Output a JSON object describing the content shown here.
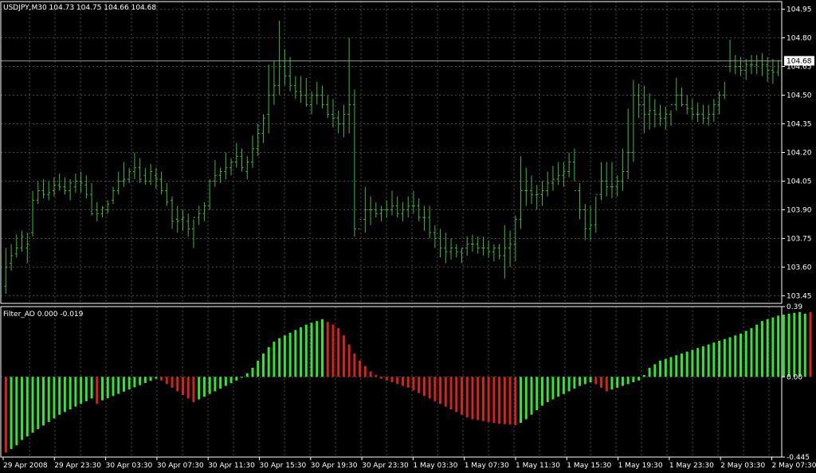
{
  "colors": {
    "background": "#000000",
    "grid": "#4a4a4a",
    "frame": "#ffffff",
    "price_bar": "#3cb93c",
    "ao_up": "#2ee82e",
    "ao_down": "#d7221c",
    "text": "#ffffff",
    "last_price_line": "#9a9a9a",
    "last_price_badge_bg": "#ffffff",
    "last_price_badge_text": "#000000"
  },
  "main_panel": {
    "header": "USDJPY,M30  104.73 104.75 104.66 104.68",
    "last_price": 104.68,
    "last_price_label": "104.68"
  },
  "indicator_panel": {
    "header": "Filter_AO 0.000 -0.019"
  },
  "chart_data": [
    {
      "type": "ohlc",
      "title": "USDJPY,M30",
      "ylim": [
        103.41,
        104.99
      ],
      "yticks": [
        "104.95",
        "104.80",
        "104.65",
        "104.50",
        "104.35",
        "104.20",
        "104.05",
        "103.90",
        "103.75",
        "103.60",
        "103.45"
      ],
      "ytick_values": [
        104.95,
        104.8,
        104.65,
        104.5,
        104.35,
        104.2,
        104.05,
        103.9,
        103.75,
        103.6,
        103.45
      ],
      "grid": true,
      "series": [
        {
          "high": [
            103.7,
            103.72,
            103.77,
            103.79,
            103.78,
            104.0,
            104.05,
            104.06,
            104.05,
            104.07,
            104.09,
            104.07,
            104.06,
            104.09,
            104.1,
            104.08,
            104.04,
            103.94,
            103.92,
            103.95,
            104.02,
            104.1,
            104.15,
            104.12,
            104.2,
            104.17,
            104.12,
            104.14,
            104.12,
            104.1,
            104.04,
            103.97,
            103.92,
            103.9,
            103.88,
            103.85,
            103.92,
            103.94,
            104.06,
            104.16,
            104.12,
            104.2,
            104.17,
            104.25,
            104.22,
            104.18,
            104.29,
            104.35,
            104.4,
            104.66,
            104.68,
            104.89,
            104.74,
            104.7,
            104.6,
            104.6,
            104.59,
            104.52,
            104.57,
            104.55,
            104.5,
            104.48,
            104.42,
            104.45,
            104.8,
            104.53,
            103.75,
            104.02,
            103.97,
            103.94,
            103.92,
            103.95,
            104.0,
            103.97,
            103.94,
            103.97,
            104.0,
            103.96,
            103.92,
            103.92,
            103.82,
            103.8,
            103.78,
            103.75,
            103.72,
            103.7,
            103.76,
            103.77,
            103.76,
            103.76,
            103.74,
            103.72,
            103.72,
            103.82,
            103.79,
            103.87,
            104.18,
            104.12,
            104.08,
            104.03,
            104.05,
            104.1,
            104.13,
            104.15,
            104.15,
            104.2,
            104.22,
            104.04,
            103.93,
            103.92,
            103.97,
            104.15,
            104.15,
            104.15,
            104.08,
            104.22,
            104.43,
            104.58,
            104.56,
            104.55,
            104.51,
            104.48,
            104.45,
            104.44,
            104.42,
            104.59,
            104.54,
            104.5,
            104.48,
            104.46,
            104.45,
            104.45,
            104.48,
            104.52,
            104.57,
            104.79,
            104.71,
            104.7,
            104.69,
            104.71,
            104.71,
            104.72,
            104.7,
            104.69,
            104.68
          ],
          "low": [
            103.46,
            103.58,
            103.65,
            103.68,
            103.62,
            103.76,
            103.93,
            103.96,
            103.95,
            103.97,
            104.0,
            103.98,
            103.95,
            103.99,
            103.99,
            103.96,
            103.87,
            103.84,
            103.86,
            103.88,
            103.93,
            103.98,
            104.02,
            104.04,
            104.06,
            104.04,
            104.03,
            104.03,
            104.01,
            103.98,
            103.92,
            103.8,
            103.78,
            103.79,
            103.76,
            103.7,
            103.82,
            103.84,
            103.9,
            104.02,
            104.04,
            104.06,
            104.08,
            104.12,
            104.1,
            104.06,
            104.12,
            104.18,
            104.25,
            104.3,
            104.45,
            104.5,
            104.55,
            104.52,
            104.48,
            104.46,
            104.44,
            104.4,
            104.45,
            104.43,
            104.38,
            104.33,
            104.3,
            104.28,
            104.3,
            103.76,
            103.75,
            103.78,
            103.82,
            103.86,
            103.84,
            103.86,
            103.87,
            103.86,
            103.84,
            103.86,
            103.88,
            103.84,
            103.79,
            103.75,
            103.7,
            103.65,
            103.62,
            103.64,
            103.65,
            103.62,
            103.66,
            103.68,
            103.67,
            103.66,
            103.65,
            103.63,
            103.64,
            103.54,
            103.6,
            103.63,
            103.8,
            103.92,
            103.93,
            103.9,
            103.92,
            103.97,
            104.0,
            104.03,
            104.02,
            104.07,
            104.05,
            103.85,
            103.74,
            103.74,
            103.78,
            103.95,
            103.97,
            103.96,
            103.97,
            104.0,
            104.06,
            104.15,
            104.38,
            104.3,
            104.32,
            104.33,
            104.34,
            104.32,
            104.34,
            104.42,
            104.44,
            104.4,
            104.37,
            104.36,
            104.35,
            104.34,
            104.36,
            104.4,
            104.48,
            104.62,
            104.61,
            104.6,
            104.58,
            104.61,
            104.61,
            104.6,
            104.57,
            104.56,
            104.6
          ],
          "open": [
            103.5,
            103.62,
            103.67,
            103.7,
            103.7,
            103.78,
            103.95,
            104.0,
            103.98,
            104.0,
            104.03,
            104.02,
            104.0,
            104.02,
            104.05,
            104.03,
            103.98,
            103.9,
            103.88,
            103.9,
            103.95,
            104.0,
            104.05,
            104.06,
            104.1,
            104.12,
            104.08,
            104.05,
            104.08,
            104.06,
            104.0,
            103.95,
            103.85,
            103.85,
            103.84,
            103.8,
            103.86,
            103.88,
            103.92,
            104.05,
            104.08,
            104.1,
            104.12,
            104.15,
            104.18,
            104.1,
            104.15,
            104.22,
            104.3,
            104.4,
            104.5,
            104.55,
            104.65,
            104.6,
            104.55,
            104.52,
            104.5,
            104.45,
            104.5,
            104.5,
            104.45,
            104.4,
            104.38,
            104.35,
            104.4,
            104.45,
            103.8,
            103.85,
            103.9,
            103.9,
            103.88,
            103.9,
            103.9,
            103.92,
            103.88,
            103.9,
            103.92,
            103.92,
            103.86,
            103.86,
            103.78,
            103.75,
            103.7,
            103.68,
            103.7,
            103.68,
            103.7,
            103.72,
            103.72,
            103.7,
            103.7,
            103.68,
            103.7,
            103.66,
            103.7,
            103.72,
            103.85,
            104.0,
            104.0,
            103.98,
            103.98,
            104.0,
            104.04,
            104.06,
            104.08,
            104.1,
            104.15,
            104.0,
            103.9,
            103.8,
            103.82,
            103.98,
            104.05,
            104.02,
            104.02,
            104.05,
            104.1,
            104.2,
            104.5,
            104.45,
            104.4,
            104.42,
            104.4,
            104.38,
            104.4,
            104.45,
            104.5,
            104.45,
            104.43,
            104.4,
            104.4,
            104.38,
            104.4,
            104.45,
            104.5,
            104.65,
            104.68,
            104.65,
            104.63,
            104.66,
            104.66,
            104.68,
            104.66,
            104.63,
            104.62
          ],
          "close": [
            103.6,
            103.66,
            103.7,
            103.76,
            103.72,
            103.95,
            104.0,
            103.98,
            103.99,
            104.03,
            104.02,
            104.0,
            104.04,
            104.05,
            104.04,
            103.98,
            103.88,
            103.88,
            103.91,
            103.93,
            104.0,
            104.05,
            104.06,
            104.1,
            104.12,
            104.06,
            104.05,
            104.1,
            104.06,
            104.0,
            103.94,
            103.84,
            103.84,
            103.86,
            103.8,
            103.86,
            103.88,
            103.92,
            104.05,
            104.08,
            104.1,
            104.12,
            104.15,
            104.18,
            104.12,
            104.15,
            104.22,
            104.3,
            104.38,
            104.5,
            104.55,
            104.65,
            104.6,
            104.55,
            104.52,
            104.5,
            104.45,
            104.5,
            104.5,
            104.45,
            104.4,
            104.38,
            104.35,
            104.4,
            104.45,
            103.8,
            103.85,
            103.9,
            103.9,
            103.88,
            103.9,
            103.9,
            103.92,
            103.88,
            103.9,
            103.92,
            103.92,
            103.86,
            103.86,
            103.78,
            103.75,
            103.7,
            103.68,
            103.7,
            103.68,
            103.7,
            103.72,
            103.72,
            103.7,
            103.7,
            103.68,
            103.7,
            103.66,
            103.7,
            103.72,
            103.85,
            104.0,
            104.0,
            103.98,
            103.98,
            104.0,
            104.04,
            104.06,
            104.08,
            104.1,
            104.15,
            104.0,
            103.9,
            103.8,
            103.82,
            103.98,
            104.05,
            104.02,
            104.02,
            104.05,
            104.1,
            104.2,
            104.5,
            104.45,
            104.4,
            104.42,
            104.4,
            104.38,
            104.4,
            104.45,
            104.5,
            104.45,
            104.43,
            104.4,
            104.4,
            104.38,
            104.4,
            104.45,
            104.5,
            104.65,
            104.68,
            104.65,
            104.63,
            104.66,
            104.66,
            104.68,
            104.66,
            104.63,
            104.62,
            104.68
          ]
        }
      ]
    },
    {
      "type": "bar",
      "title": "Filter_AO",
      "ylim": [
        -0.445,
        0.39
      ],
      "yticks": [
        "0.39",
        "0.00",
        "-0.445"
      ],
      "ytick_values": [
        0.39,
        0.0,
        -0.445
      ],
      "grid": true,
      "series": [
        {
          "name": "Filter_AO",
          "values": [
            -0.42,
            -0.4,
            -0.38,
            -0.35,
            -0.33,
            -0.31,
            -0.29,
            -0.27,
            -0.25,
            -0.23,
            -0.21,
            -0.195,
            -0.18,
            -0.165,
            -0.15,
            -0.135,
            -0.12,
            -0.15,
            -0.13,
            -0.118,
            -0.106,
            -0.094,
            -0.082,
            -0.07,
            -0.058,
            -0.046,
            -0.034,
            -0.022,
            -0.01,
            -0.02,
            -0.04,
            -0.06,
            -0.08,
            -0.1,
            -0.12,
            -0.14,
            -0.125,
            -0.11,
            -0.095,
            -0.08,
            -0.065,
            -0.05,
            -0.035,
            -0.02,
            -0.005,
            0.02,
            0.05,
            0.09,
            0.13,
            0.165,
            0.195,
            0.215,
            0.23,
            0.245,
            0.26,
            0.275,
            0.29,
            0.3,
            0.31,
            0.32,
            0.305,
            0.29,
            0.27,
            0.23,
            0.18,
            0.13,
            0.09,
            0.06,
            0.03,
            0.01,
            -0.01,
            -0.02,
            -0.03,
            -0.04,
            -0.05,
            -0.06,
            -0.075,
            -0.09,
            -0.105,
            -0.12,
            -0.135,
            -0.15,
            -0.165,
            -0.18,
            -0.195,
            -0.21,
            -0.225,
            -0.235,
            -0.24,
            -0.245,
            -0.25,
            -0.255,
            -0.26,
            -0.262,
            -0.265,
            -0.268,
            -0.255,
            -0.235,
            -0.21,
            -0.185,
            -0.16,
            -0.14,
            -0.125,
            -0.11,
            -0.095,
            -0.08,
            -0.065,
            -0.05,
            -0.04,
            -0.03,
            -0.04,
            -0.06,
            -0.08,
            -0.07,
            -0.06,
            -0.05,
            -0.04,
            -0.03,
            -0.02,
            0.01,
            0.05,
            0.07,
            0.09,
            0.1,
            0.11,
            0.12,
            0.13,
            0.14,
            0.15,
            0.16,
            0.17,
            0.18,
            0.19,
            0.2,
            0.21,
            0.22,
            0.23,
            0.24,
            0.255,
            0.27,
            0.29,
            0.31,
            0.32,
            0.33,
            0.34,
            0.345,
            0.35,
            0.355,
            0.36,
            0.35,
            0.36
          ],
          "colors": [
            "down",
            "up",
            "up",
            "up",
            "up",
            "up",
            "up",
            "up",
            "up",
            "up",
            "up",
            "up",
            "up",
            "up",
            "up",
            "up",
            "up",
            "down",
            "up",
            "up",
            "up",
            "up",
            "up",
            "up",
            "up",
            "up",
            "up",
            "up",
            "up",
            "down",
            "down",
            "down",
            "down",
            "down",
            "down",
            "down",
            "up",
            "up",
            "up",
            "up",
            "up",
            "up",
            "up",
            "up",
            "up",
            "up",
            "up",
            "up",
            "up",
            "up",
            "up",
            "up",
            "up",
            "up",
            "up",
            "up",
            "up",
            "up",
            "up",
            "up",
            "down",
            "down",
            "down",
            "down",
            "down",
            "down",
            "down",
            "down",
            "down",
            "down",
            "down",
            "down",
            "down",
            "down",
            "down",
            "down",
            "down",
            "down",
            "down",
            "down",
            "down",
            "down",
            "down",
            "down",
            "down",
            "down",
            "down",
            "down",
            "down",
            "down",
            "down",
            "down",
            "down",
            "down",
            "down",
            "down",
            "up",
            "up",
            "up",
            "up",
            "up",
            "up",
            "up",
            "up",
            "up",
            "up",
            "up",
            "up",
            "up",
            "up",
            "down",
            "down",
            "down",
            "up",
            "up",
            "up",
            "up",
            "up",
            "up",
            "up",
            "up",
            "up",
            "up",
            "up",
            "up",
            "up",
            "up",
            "up",
            "up",
            "up",
            "up",
            "up",
            "up",
            "up",
            "up",
            "up",
            "up",
            "up",
            "up",
            "up",
            "up",
            "up",
            "up",
            "up",
            "up",
            "up",
            "up",
            "up",
            "up",
            "up",
            "down",
            "up"
          ]
        }
      ]
    }
  ],
  "x_axis": {
    "labels": [
      "29 Apr 2008",
      "29 Apr 23:30",
      "30 Apr 03:30",
      "30 Apr 07:30",
      "30 Apr 11:30",
      "30 Apr 15:30",
      "30 Apr 19:30",
      "30 Apr 23:30",
      "1 May 03:30",
      "1 May 07:30",
      "1 May 11:30",
      "1 May 15:30",
      "1 May 19:30",
      "1 May 23:30",
      "2 May 03:30",
      "2 May 07:30"
    ]
  }
}
